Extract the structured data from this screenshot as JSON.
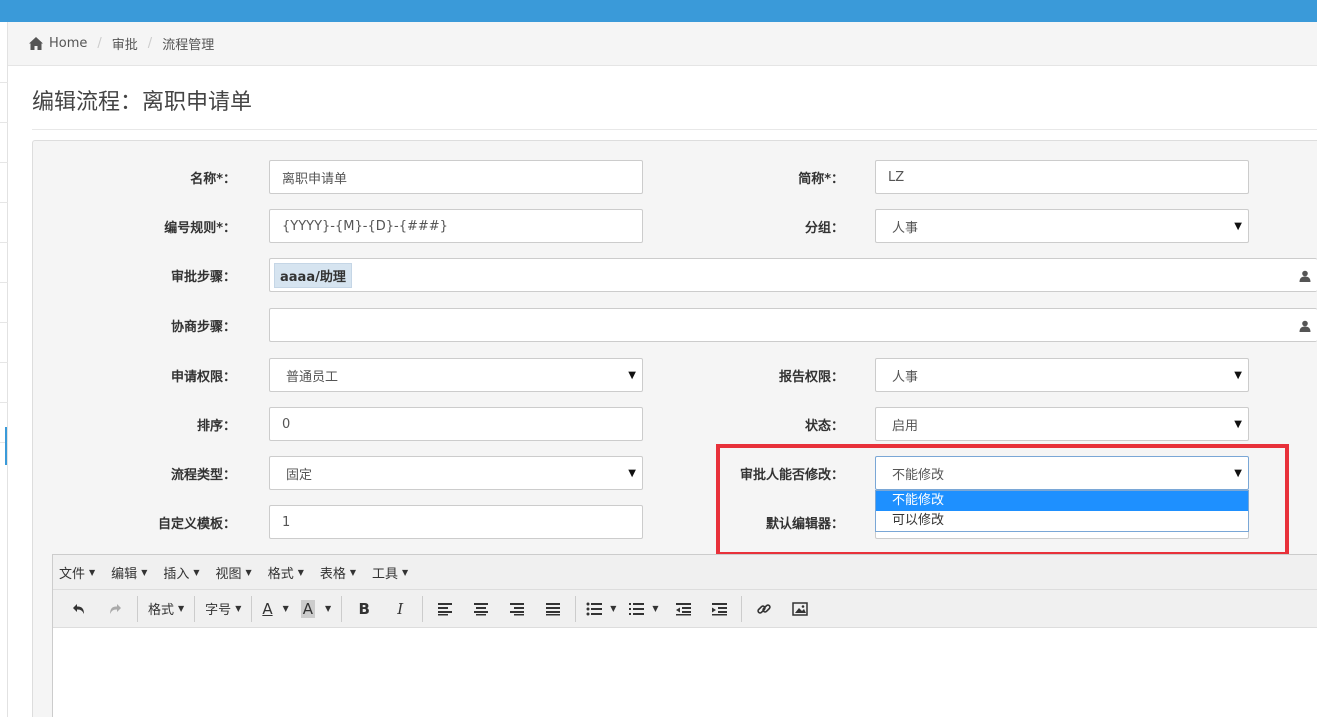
{
  "breadcrumb": {
    "home": "Home",
    "level1": "审批",
    "level2": "流程管理"
  },
  "page": {
    "title": "编辑流程：离职申请单"
  },
  "form": {
    "name": {
      "label": "名称*：",
      "value": "离职申请单"
    },
    "short_name": {
      "label": "简称*：",
      "value": "LZ"
    },
    "number_rule": {
      "label": "编号规则*：",
      "value": "{YYYY}-{M}-{D}-{###}"
    },
    "group": {
      "label": "分组：",
      "value": "人事"
    },
    "approval_steps": {
      "label": "审批步骤：",
      "tag": "aaaa/助理"
    },
    "consult_steps": {
      "label": "协商步骤：",
      "value": ""
    },
    "apply_permission": {
      "label": "申请权限：",
      "value": "普通员工"
    },
    "report_permission": {
      "label": "报告权限：",
      "value": "人事"
    },
    "sort": {
      "label": "排序：",
      "value": "0"
    },
    "status": {
      "label": "状态：",
      "value": "启用"
    },
    "flow_type": {
      "label": "流程类型：",
      "value": "固定"
    },
    "approver_editable": {
      "label": "审批人能否修改：",
      "value": "不能修改",
      "options": [
        "不能修改",
        "可以修改"
      ],
      "selected_index": 0
    },
    "custom_template": {
      "label": "自定义模板：",
      "value": "1"
    },
    "default_editor": {
      "label": "默认编辑器："
    }
  },
  "editor": {
    "menus": [
      "文件",
      "编辑",
      "插入",
      "视图",
      "格式",
      "表格",
      "工具"
    ],
    "toolbar": {
      "format": "格式",
      "font_size": "字号",
      "font_color": "A",
      "bg_color": "A",
      "bold": "B",
      "italic": "I"
    }
  },
  "colors": {
    "topbar": "#3a9ad9",
    "highlight": "#e8313a",
    "selected_option": "#1e90ff"
  }
}
